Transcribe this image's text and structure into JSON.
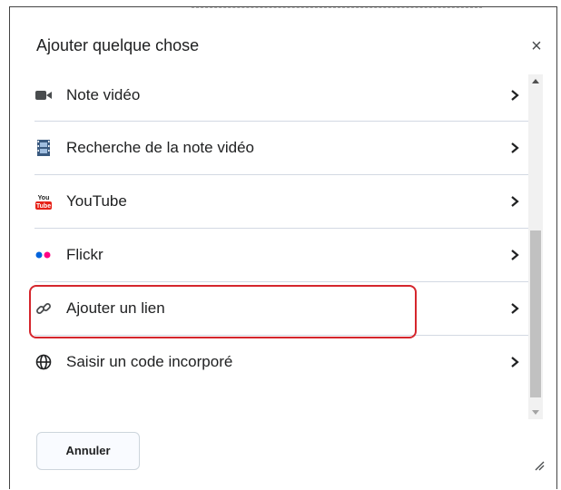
{
  "dialog": {
    "title": "Ajouter quelque chose",
    "close_label": "×"
  },
  "items": [
    {
      "label": "Note vidéo",
      "icon": "video-camera-icon"
    },
    {
      "label": "Recherche de la note vidéo",
      "icon": "film-strip-icon"
    },
    {
      "label": "YouTube",
      "icon": "youtube-icon"
    },
    {
      "label": "Flickr",
      "icon": "flickr-icon"
    },
    {
      "label": "Ajouter un lien",
      "icon": "link-icon"
    },
    {
      "label": "Saisir un code incorporé",
      "icon": "globe-icon"
    }
  ],
  "footer": {
    "cancel_label": "Annuler"
  },
  "colors": {
    "highlight": "#d5262d",
    "youtube_red": "#e62117",
    "flickr_blue": "#0063dc",
    "flickr_pink": "#ff0084"
  }
}
